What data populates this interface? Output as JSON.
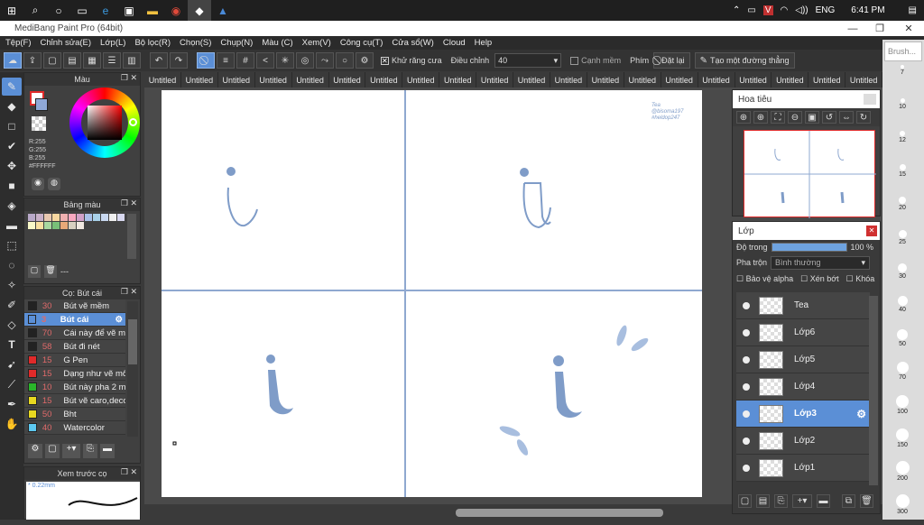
{
  "taskbar": {
    "lang": "ENG",
    "time": "6:41 PM"
  },
  "window": {
    "title": "MediBang Paint Pro (64bit)"
  },
  "menu": [
    "Tệp(F)",
    "Chỉnh sửa(E)",
    "Lớp(L)",
    "Bộ lọc(R)",
    "Chọn(S)",
    "Chụp(N)",
    "Màu (C)",
    "Xem(V)",
    "Công cụ(T)",
    "Cửa sổ(W)",
    "Cloud",
    "Help"
  ],
  "toolbar": {
    "antialias": "Khử răng cưa",
    "adjust": "Điều chỉnh",
    "adjust_value": "40",
    "smooth": "Cạnh mềm",
    "key": "Phím",
    "reset": "Đặt lại",
    "straight": "Tạo một đường thẳng"
  },
  "brush_search": {
    "placeholder": "Brush..."
  },
  "tabs": [
    "Untitled",
    "Untitled",
    "Untitled",
    "Untitled",
    "Untitled",
    "Untitled",
    "Untitled",
    "Untitled",
    "Untitled",
    "Untitled",
    "Untitled",
    "Untitled",
    "Untitled",
    "Untitled",
    "Untitled",
    "Untitled",
    "Untitled",
    "Untitled",
    "Untitled",
    "Untitled"
  ],
  "color_panel": {
    "title": "Màu",
    "r": "R:255",
    "g": "G:255",
    "b": "B:255",
    "hex": "#FFFFFF"
  },
  "palette_panel": {
    "title": "Bảng màu",
    "dash": "---"
  },
  "brush_panel": {
    "title": "Cọ: Bút cái",
    "items": [
      {
        "size": "30",
        "name": "Bút vẽ mềm",
        "color": "#222222"
      },
      {
        "size": "3",
        "name": "Bút cái",
        "color": "#5b8fd6",
        "sel": true
      },
      {
        "size": "70",
        "name": "Cái này để vẽ mã",
        "color": "#222222"
      },
      {
        "size": "58",
        "name": "Bút đi nét",
        "color": "#222222"
      },
      {
        "size": "15",
        "name": "G Pen",
        "color": "#e02a2a"
      },
      {
        "size": "15",
        "name": "Dạng như vẽ môi",
        "color": "#e02a2a"
      },
      {
        "size": "10",
        "name": "Bút này pha 2 mà",
        "color": "#2ab52a"
      },
      {
        "size": "15",
        "name": "Bút vẽ caro,deco",
        "color": "#e8d820"
      },
      {
        "size": "50",
        "name": "Bht",
        "color": "#e8d820"
      },
      {
        "size": "40",
        "name": "Watercolor",
        "color": "#5cc8f0"
      }
    ]
  },
  "preview_panel": {
    "title": "Xem trước cọ",
    "size": "0.22mm"
  },
  "navigator": {
    "title": "Hoa tiêu"
  },
  "layers_panel": {
    "title": "Lớp",
    "opacity_label": "Độ trong",
    "opacity_value": "100 %",
    "opacity": 1.0,
    "blend_label": "Pha trộn",
    "blend_value": "Bình thường",
    "protect_alpha": "Bảo vệ alpha",
    "clip": "Xén bớt",
    "lock": "Khóa",
    "layers": [
      {
        "name": "Tea"
      },
      {
        "name": "Lớp6"
      },
      {
        "name": "Lớp5"
      },
      {
        "name": "Lớp4"
      },
      {
        "name": "Lớp3",
        "sel": true
      },
      {
        "name": "Lớp2"
      },
      {
        "name": "Lớp1"
      }
    ]
  },
  "canvas": {
    "watermark": [
      "Tea",
      "@bisoma197",
      "#heldop247"
    ]
  },
  "brush_sizes": [
    "7",
    "10",
    "12",
    "15",
    "20",
    "25",
    "30",
    "40",
    "50",
    "70",
    "100",
    "150",
    "200",
    "300"
  ]
}
